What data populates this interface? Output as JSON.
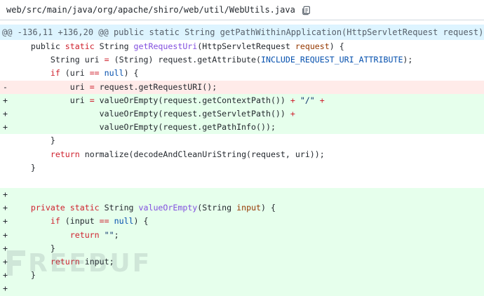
{
  "file": {
    "path": "web/src/main/java/org/apache/shiro/web/util/WebUtils.java",
    "copy_icon": "copy-icon"
  },
  "hunk": {
    "header": "@@ -136,11 +136,20 @@ public static String getPathWithinApplication(HttpServletRequest request) {"
  },
  "lines": [
    {
      "type": "ctx",
      "marker": "",
      "tokens": [
        [
          "    ",
          ""
        ],
        [
          "public",
          ""
        ],
        [
          " ",
          ""
        ],
        [
          "static",
          "k"
        ],
        [
          " String ",
          ""
        ],
        [
          "getRequestUri",
          "f"
        ],
        [
          "(HttpServletRequest ",
          ""
        ],
        [
          "request",
          "p"
        ],
        [
          ") {",
          ""
        ]
      ]
    },
    {
      "type": "ctx",
      "marker": "",
      "tokens": [
        [
          "        String uri ",
          ""
        ],
        [
          "=",
          "k"
        ],
        [
          " (String) request.getAttribute(",
          ""
        ],
        [
          "INCLUDE_REQUEST_URI_ATTRIBUTE",
          "c"
        ],
        [
          ");",
          ""
        ]
      ]
    },
    {
      "type": "ctx",
      "marker": "",
      "tokens": [
        [
          "        ",
          ""
        ],
        [
          "if",
          "k"
        ],
        [
          " (uri ",
          ""
        ],
        [
          "==",
          "k"
        ],
        [
          " ",
          ""
        ],
        [
          "null",
          "c"
        ],
        [
          ") {",
          ""
        ]
      ]
    },
    {
      "type": "del",
      "marker": "-",
      "tokens": [
        [
          "            uri ",
          ""
        ],
        [
          "=",
          "k"
        ],
        [
          " request.getRequestURI();",
          ""
        ]
      ]
    },
    {
      "type": "add",
      "marker": "+",
      "tokens": [
        [
          "            uri ",
          ""
        ],
        [
          "=",
          "k"
        ],
        [
          " valueOrEmpty(request.getContextPath()) ",
          ""
        ],
        [
          "+",
          "k"
        ],
        [
          " ",
          ""
        ],
        [
          "\"/\"",
          "s"
        ],
        [
          " ",
          ""
        ],
        [
          "+",
          "k"
        ]
      ]
    },
    {
      "type": "add",
      "marker": "+",
      "tokens": [
        [
          "                  valueOrEmpty(request.getServletPath()) ",
          ""
        ],
        [
          "+",
          "k"
        ]
      ]
    },
    {
      "type": "add",
      "marker": "+",
      "tokens": [
        [
          "                  valueOrEmpty(request.getPathInfo());",
          ""
        ]
      ]
    },
    {
      "type": "ctx",
      "marker": "",
      "tokens": [
        [
          "        }",
          ""
        ]
      ]
    },
    {
      "type": "ctx",
      "marker": "",
      "tokens": [
        [
          "        ",
          ""
        ],
        [
          "return",
          "k"
        ],
        [
          " normalize(decodeAndCleanUriString(request, uri));",
          ""
        ]
      ]
    },
    {
      "type": "ctx",
      "marker": "",
      "tokens": [
        [
          "    }",
          ""
        ]
      ]
    },
    {
      "type": "ctx",
      "marker": "",
      "tokens": [
        [
          "",
          ""
        ]
      ]
    },
    {
      "type": "add",
      "marker": "+",
      "tokens": [
        [
          "",
          ""
        ]
      ]
    },
    {
      "type": "add",
      "marker": "+",
      "tokens": [
        [
          "    ",
          ""
        ],
        [
          "private",
          "k"
        ],
        [
          " ",
          ""
        ],
        [
          "static",
          "k"
        ],
        [
          " String ",
          ""
        ],
        [
          "valueOrEmpty",
          "f"
        ],
        [
          "(String ",
          ""
        ],
        [
          "input",
          "p"
        ],
        [
          ") {",
          ""
        ]
      ]
    },
    {
      "type": "add",
      "marker": "+",
      "tokens": [
        [
          "        ",
          ""
        ],
        [
          "if",
          "k"
        ],
        [
          " (input ",
          ""
        ],
        [
          "==",
          "k"
        ],
        [
          " ",
          ""
        ],
        [
          "null",
          "c"
        ],
        [
          ") {",
          ""
        ]
      ]
    },
    {
      "type": "add",
      "marker": "+",
      "tokens": [
        [
          "            ",
          ""
        ],
        [
          "return",
          "k"
        ],
        [
          " ",
          ""
        ],
        [
          "\"\"",
          "s"
        ],
        [
          ";",
          ""
        ]
      ]
    },
    {
      "type": "add",
      "marker": "+",
      "tokens": [
        [
          "        }",
          ""
        ]
      ]
    },
    {
      "type": "add",
      "marker": "+",
      "tokens": [
        [
          "        ",
          ""
        ],
        [
          "return",
          "k"
        ],
        [
          " input;",
          ""
        ]
      ]
    },
    {
      "type": "add",
      "marker": "+",
      "tokens": [
        [
          "    }",
          ""
        ]
      ]
    },
    {
      "type": "add",
      "marker": "+",
      "tokens": [
        [
          "",
          ""
        ]
      ]
    }
  ],
  "watermark": {
    "text": "REEBUF",
    "icon": "freebuf-logo-icon"
  }
}
